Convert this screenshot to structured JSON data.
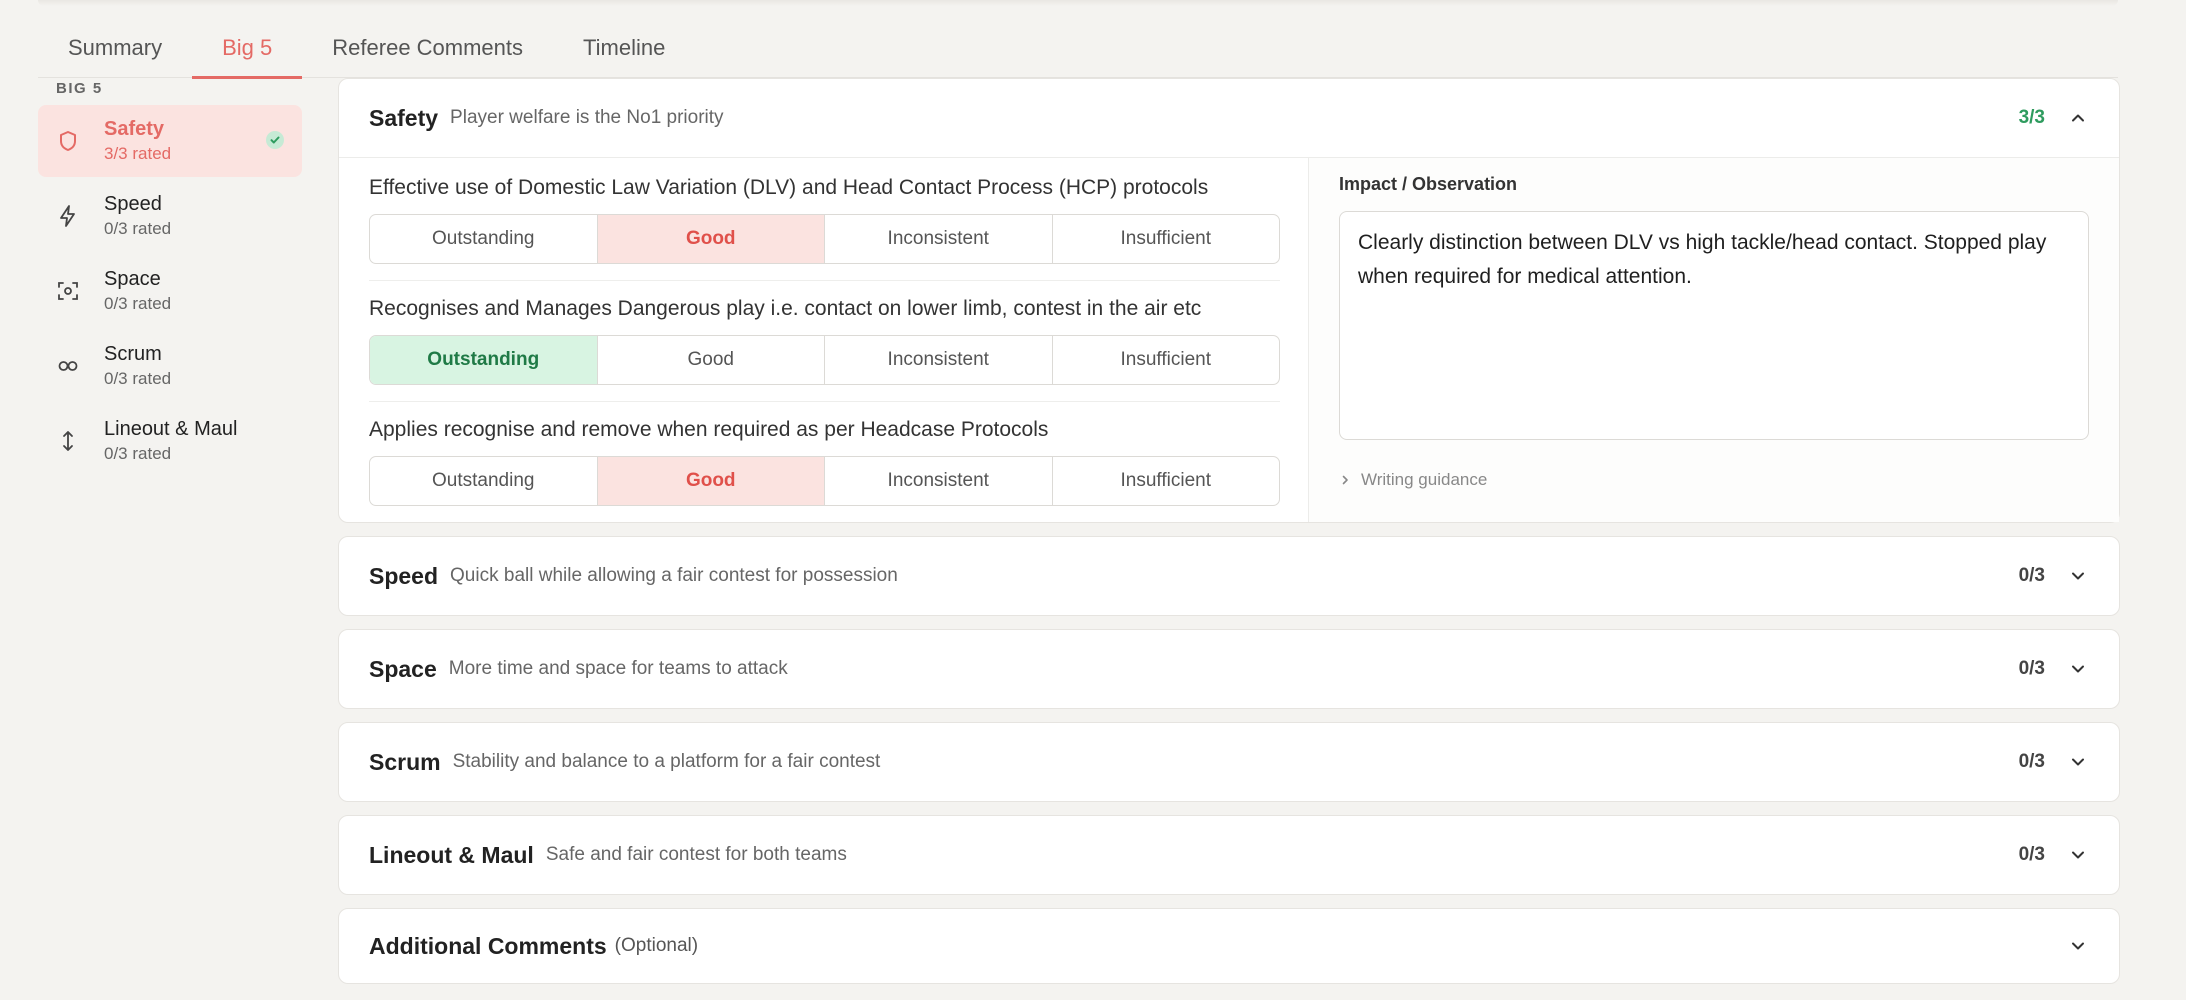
{
  "tabs": [
    {
      "label": "Summary"
    },
    {
      "label": "Big 5"
    },
    {
      "label": "Referee Comments"
    },
    {
      "label": "Timeline"
    }
  ],
  "sidebar": {
    "heading": "BIG 5",
    "items": [
      {
        "label": "Safety",
        "sub": "3/3 rated",
        "icon": "shield-icon"
      },
      {
        "label": "Speed",
        "sub": "0/3 rated",
        "icon": "lightning-icon"
      },
      {
        "label": "Space",
        "sub": "0/3 rated",
        "icon": "focus-icon"
      },
      {
        "label": "Scrum",
        "sub": "0/3 rated",
        "icon": "infinity-icon"
      },
      {
        "label": "Lineout & Maul",
        "sub": "0/3 rated",
        "icon": "vertical-arrows-icon"
      }
    ]
  },
  "sections": {
    "safety": {
      "title": "Safety",
      "desc": "Player welfare is the No1 priority",
      "score": "3/3",
      "criteria": [
        {
          "label": "Effective use of Domestic Law Variation (DLV) and Head Contact Process (HCP) protocols",
          "selected": "Good"
        },
        {
          "label": "Recognises and Manages Dangerous play i.e. contact on lower limb, contest in the air etc",
          "selected": "Outstanding"
        },
        {
          "label": "Applies recognise and remove when required as per Headcase Protocols",
          "selected": "Good"
        }
      ],
      "ratings": [
        "Outstanding",
        "Good",
        "Inconsistent",
        "Insufficient"
      ],
      "observation_label": "Impact / Observation",
      "observation_text": "Clearly distinction between DLV vs high tackle/head contact. Stopped play when required for medical attention.",
      "guidance_label": "Writing guidance"
    },
    "speed": {
      "title": "Speed",
      "desc": "Quick ball while allowing a fair contest for possession",
      "score": "0/3"
    },
    "space": {
      "title": "Space",
      "desc": "More time and space for teams to attack",
      "score": "0/3"
    },
    "scrum": {
      "title": "Scrum",
      "desc": "Stability and balance to a platform for a fair contest",
      "score": "0/3"
    },
    "lineout": {
      "title": "Lineout & Maul",
      "desc": "Safe and fair contest for both teams",
      "score": "0/3"
    },
    "additional": {
      "title": "Additional Comments",
      "optional": "(Optional)"
    }
  },
  "colors": {
    "accent": "#e46a65",
    "success": "#2e9b5e"
  }
}
